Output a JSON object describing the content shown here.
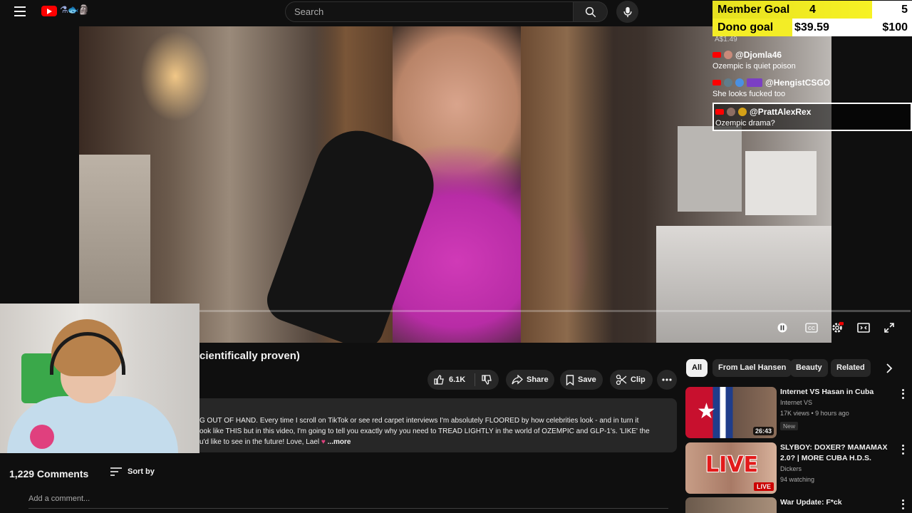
{
  "topbar": {
    "search_placeholder": "Search"
  },
  "goals": {
    "member_label": "Member Goal",
    "member_current": "4",
    "member_target": "5",
    "member_progress": 0.8,
    "dono_label": "Dono goal",
    "dono_current": "$39.59",
    "dono_target": "$100",
    "dono_progress": 0.4
  },
  "chat": {
    "amount": "A$1.49",
    "messages": [
      {
        "user": "@Djomla46",
        "text": "Ozempic is quiet poison"
      },
      {
        "user": "@HengistCSGO",
        "text": "She looks fucked too"
      },
      {
        "user": "@PrattAlexRex",
        "text": "Ozempic drama?"
      }
    ]
  },
  "video": {
    "title_visible": "cientifically proven)"
  },
  "actions": {
    "like_count": "6.1K",
    "share": "Share",
    "save": "Save",
    "clip": "Clip"
  },
  "description": {
    "line1": "G OUT OF HAND. Every time I scroll on TikTok or see red carpet interviews I'm absolutely FLOORED by how celebrities look - and in turn it",
    "line2": "ook like THIS but in this video, I'm going to tell you exactly why you need to TREAD LIGHTLY in the world of OZEMPIC and GLP-1's. 'LIKE' the",
    "line3": "u'd like to see in the future! Love, Lael",
    "more": "...more"
  },
  "comments": {
    "count": "1,229 Comments",
    "sort": "Sort by",
    "add_placeholder": "Add a comment..."
  },
  "chips": [
    "All",
    "From Lael Hansen",
    "Beauty",
    "Related"
  ],
  "recommendations": [
    {
      "title": "Internet VS Hasan in Cuba",
      "channel": "Internet VS",
      "meta": "17K views • 9 hours ago",
      "badge": "New",
      "duration": "26:43"
    },
    {
      "title": "SLYBOY: DOXER? MAMAMAX 2.0? | MORE CUBA H.D.S.",
      "channel": "Dickers",
      "meta": "94 watching",
      "live": "LIVE",
      "thumb_text": "LIVE"
    },
    {
      "title": "War Update: F*ck"
    }
  ],
  "colors": {
    "accent_red": "#ff0000",
    "goal_yellow": "#f3ed26",
    "bg": "#0f0f0f"
  }
}
